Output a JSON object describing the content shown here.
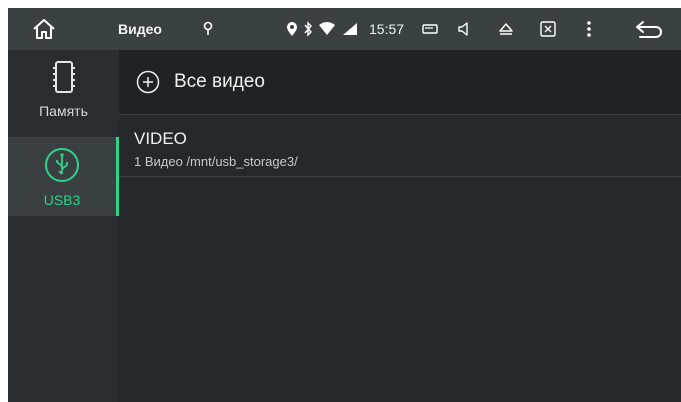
{
  "status_bar": {
    "title": "Видео",
    "time": "15:57",
    "icons": [
      "home-icon",
      "location-icon",
      "location-icon",
      "bluetooth-icon",
      "wifi-icon",
      "signal-icon",
      "window-icon",
      "volume-icon",
      "eject-icon",
      "close-box-icon",
      "more-icon",
      "back-icon"
    ]
  },
  "sidebar": {
    "items": [
      {
        "label": "Память",
        "icon": "sd-card-icon",
        "selected": false
      },
      {
        "label": "USB3",
        "icon": "usb-icon",
        "selected": true
      }
    ]
  },
  "main": {
    "all_videos_label": "Все видео",
    "folders": [
      {
        "name": "VIDEO",
        "details": "1 Видео /mnt/usb_storage3/"
      }
    ]
  },
  "colors": {
    "accent": "#2fd38a",
    "status_bar": "#3b4043",
    "background": "#1f2326"
  }
}
